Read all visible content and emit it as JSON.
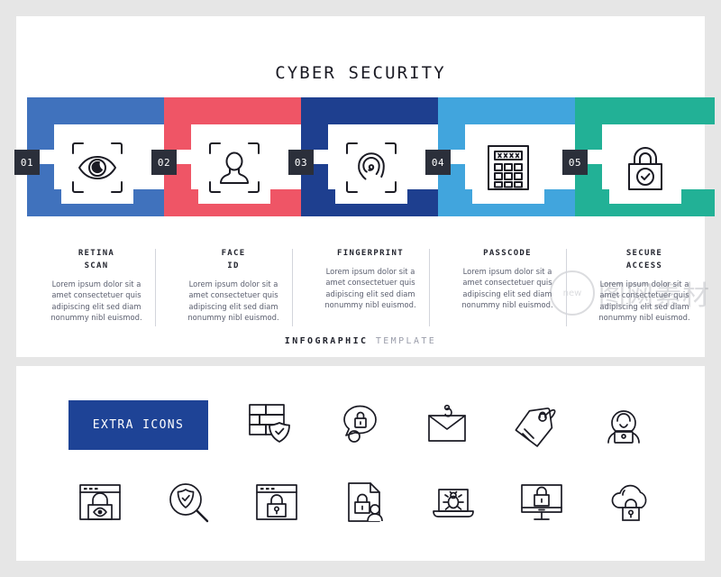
{
  "page": {
    "background": "#e6e6e6",
    "panel_background": "#ffffff"
  },
  "main": {
    "title": "CYBER SECURITY",
    "footer_bold": "INFOGRAPHIC",
    "footer_light": "TEMPLATE",
    "body_text": "Lorem ipsum dolor sit a\namet consectetuer quis\nadipiscing elit sed diam\nnonummy nibl euismod.",
    "steps": [
      {
        "number": "01",
        "heading_line1": "RETINA",
        "heading_line2": "SCAN",
        "color": "#4072bd",
        "icon": "retina-scan-icon",
        "body": "Lorem ipsum dolor sit a\namet consectetuer quis\nadipiscing elit sed diam\nnonummy nibl euismod."
      },
      {
        "number": "02",
        "heading_line1": "FACE",
        "heading_line2": "ID",
        "color": "#ef5566",
        "icon": "face-id-icon",
        "body": "Lorem ipsum dolor sit a\namet consectetuer quis\nadipiscing elit sed diam\nnonummy nibl euismod."
      },
      {
        "number": "03",
        "heading_line1": "FINGERPRINT",
        "heading_line2": "",
        "color": "#1e3f8f",
        "icon": "fingerprint-icon",
        "body": "Lorem ipsum dolor sit a\namet consectetuer quis\nadipiscing elit sed diam\nnonummy nibl euismod."
      },
      {
        "number": "04",
        "heading_line1": "PASSCODE",
        "heading_line2": "",
        "color": "#41a5dd",
        "icon": "passcode-keypad-icon",
        "body": "Lorem ipsum dolor sit a\namet consectetuer quis\nadipiscing elit sed diam\nnonummy nibl euismod."
      },
      {
        "number": "05",
        "heading_line1": "SECURE",
        "heading_line2": "ACCESS",
        "color": "#22b196",
        "icon": "secure-access-padlock-icon",
        "body": "Lorem ipsum dolor sit a\namet consectetuer quis\nadipiscing elit sed diam\nnonummy nibl euismod."
      }
    ]
  },
  "extra": {
    "label": "EXTRA ICONS",
    "label_color": "#1e4396",
    "icons": [
      "firewall-shield-icon",
      "chat-lock-icon",
      "phishing-email-icon",
      "tag-lock-icon",
      "hacker-laptop-icon",
      "browser-lock-eye-icon",
      "magnifier-shield-icon",
      "browser-padlock-icon",
      "document-lock-user-icon",
      "laptop-bug-icon",
      "monitor-lock-icon",
      "cloud-padlock-icon"
    ]
  },
  "watermark": {
    "ring_text": "new",
    "cjk_text": "图网素材"
  }
}
